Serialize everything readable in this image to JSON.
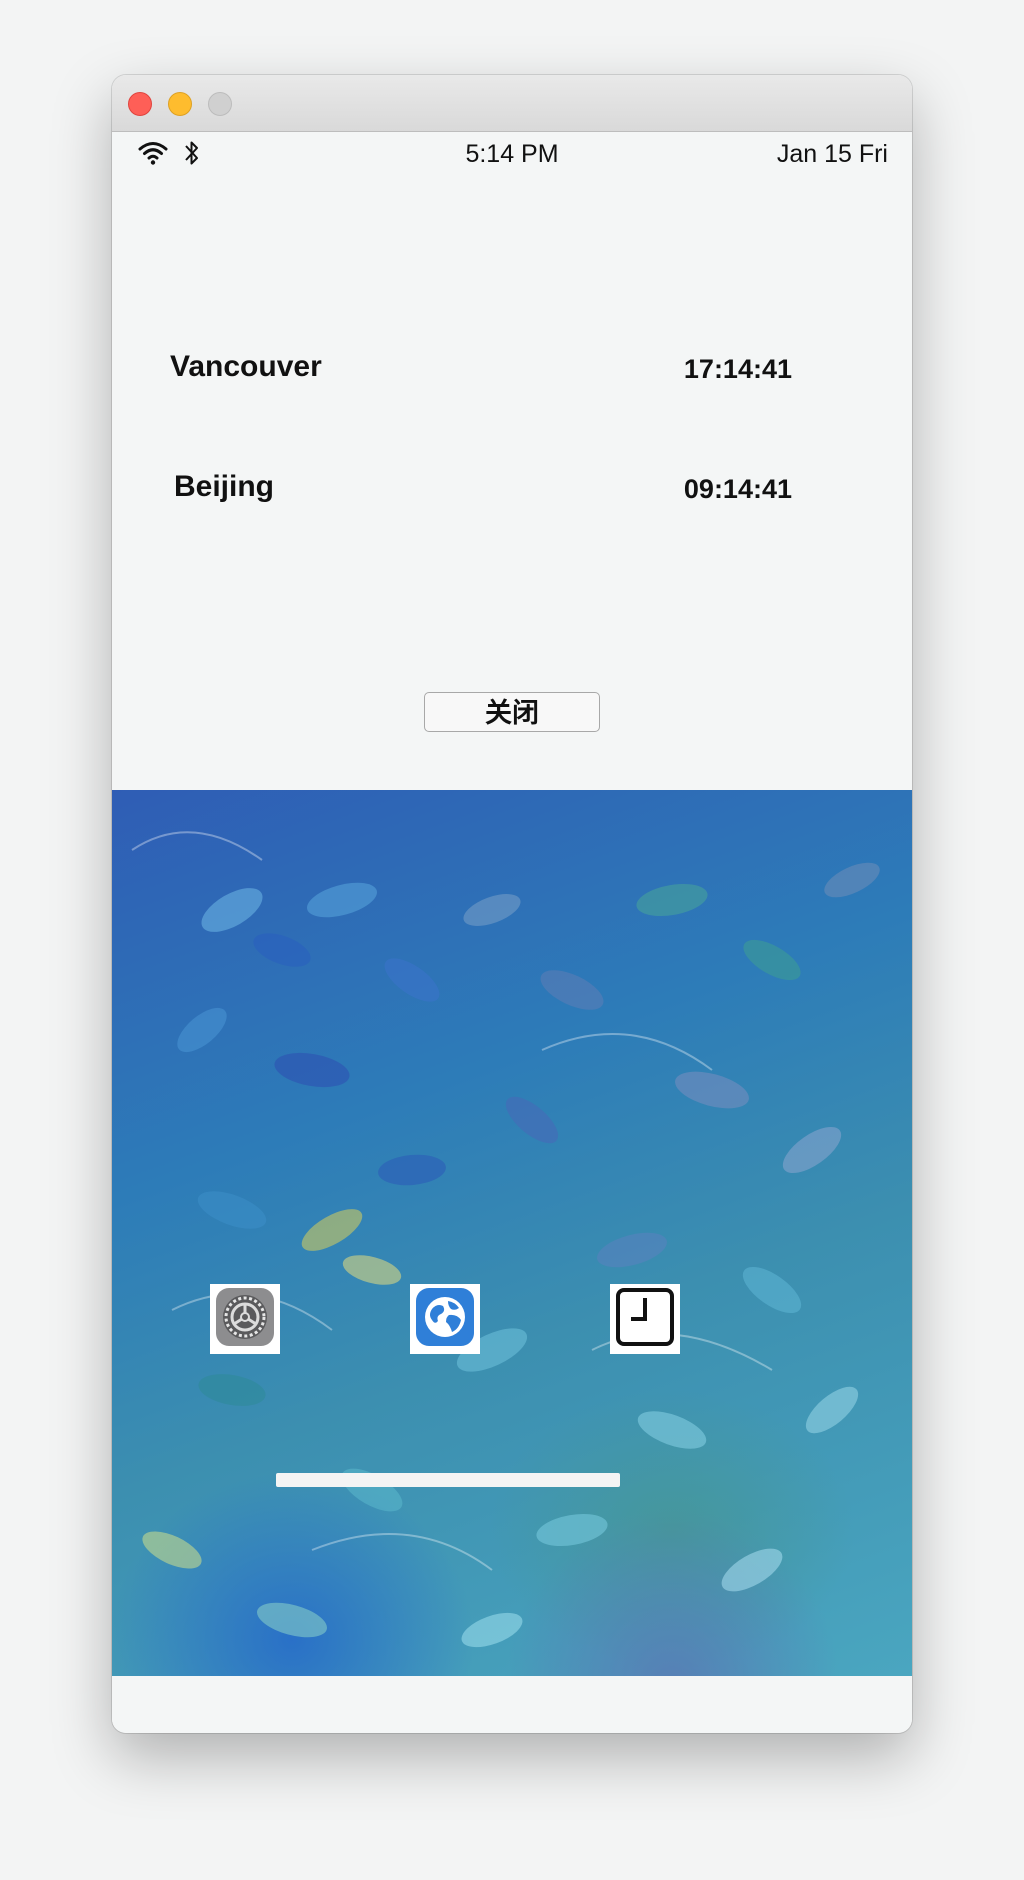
{
  "status_bar": {
    "time": "5:14 PM",
    "date": "Jan 15 Fri",
    "wifi_icon": "wifi-icon",
    "bluetooth_icon": "bluetooth-icon"
  },
  "world_clock": {
    "rows": [
      {
        "city": "Vancouver",
        "time": "17:14:41"
      },
      {
        "city": "Beijing",
        "time": "09:14:41"
      }
    ],
    "close_label": "关闭"
  },
  "dock": {
    "apps": [
      {
        "icon": "settings-gear-icon"
      },
      {
        "icon": "globe-icon"
      },
      {
        "icon": "clock-icon"
      }
    ]
  },
  "colors": {
    "traffic_close": "#fe5f57",
    "traffic_minimize": "#febc2e",
    "traffic_maximize": "#d0d0d0",
    "screen_background": "#f4f6f6",
    "globe_blue": "#2f7fd8"
  }
}
